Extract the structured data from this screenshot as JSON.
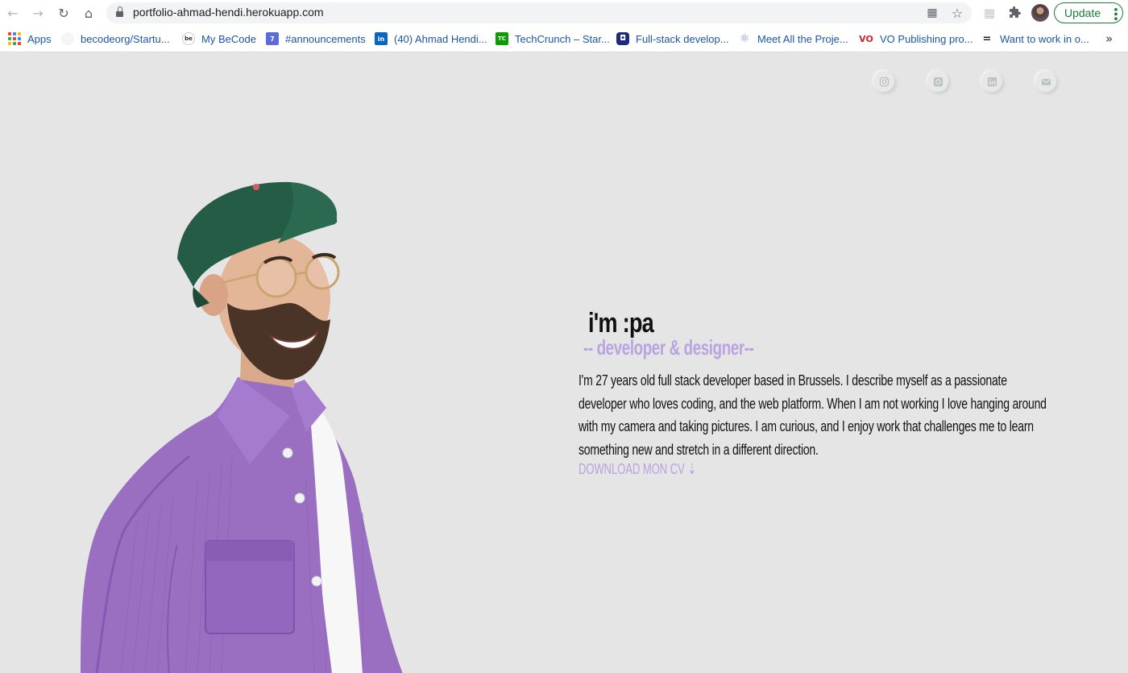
{
  "browser": {
    "url": "portfolio-ahmad-hendi.herokuapp.com",
    "update_label": "Update",
    "icons": {
      "back": "arrow-left-icon",
      "forward": "arrow-right-icon",
      "reload": "reload-icon",
      "home": "home-icon",
      "lock": "lock-icon",
      "qr": "qr-code-icon",
      "star": "star-icon",
      "extension": "puzzle-icon",
      "menu": "kebab-menu-icon"
    },
    "accent": "#188038"
  },
  "bookmarks": {
    "items": [
      {
        "label": "Apps",
        "icon": "apps-grid-icon"
      },
      {
        "label": "becodeorg/Startu...",
        "icon": "github-icon"
      },
      {
        "label": "My BeCode",
        "icon": "becode-icon"
      },
      {
        "label": "#announcements",
        "icon": "slack-icon"
      },
      {
        "label": "(40) Ahmad Hendi...",
        "icon": "linkedin-icon"
      },
      {
        "label": "TechCrunch – Star...",
        "icon": "techcrunch-icon"
      },
      {
        "label": "Full-stack develop...",
        "icon": "site-icon"
      },
      {
        "label": "Meet All the Proje...",
        "icon": "react-icon"
      },
      {
        "label": "VO Publishing pro...",
        "icon": "vo-icon"
      },
      {
        "label": "Want to work in o...",
        "icon": "list-icon"
      }
    ],
    "more": "»"
  },
  "social": {
    "items": [
      "instagram-icon",
      "github-icon",
      "linkedin-icon",
      "mail-icon"
    ],
    "color": "#b8c4bd"
  },
  "hero": {
    "title": "i'm :pa",
    "subtitle": "-- developer & designer--",
    "description": "I'm 27 years old full stack developer based in Brussels. I describe myself as a passionate   developer who loves coding, and the web platform. When I am not working I love hanging around with my camera and taking pictures. I am curious, and I enjoy work that challenges me to learn something new and stretch in a different direction.",
    "cv_label": "DOWNLOAD MON CV ⇣",
    "accent": "#b9a3e0"
  }
}
